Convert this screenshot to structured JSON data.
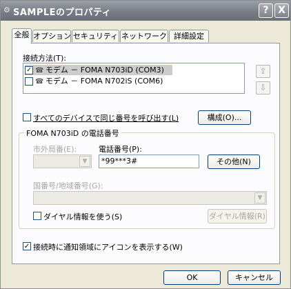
{
  "window": {
    "title": "SAMPLEのプロパティ",
    "help_label": "?",
    "close_label": "X"
  },
  "tabs": [
    "全般",
    "オプション",
    "セキュリティ",
    "ネットワーク",
    "詳細設定"
  ],
  "connect_method": {
    "label": "接続方法(T):",
    "items": [
      {
        "label": "モデム － FOMA N703iD (COM3)",
        "checked": true,
        "selected": true
      },
      {
        "label": "モデム － FOMA N702iS (COM6)",
        "checked": false,
        "selected": false
      }
    ],
    "up_icon": "⇧",
    "down_icon": "⇩"
  },
  "same_number": {
    "label": "すべてのデバイスで同じ番号を呼び出す(L)",
    "checked": false
  },
  "configure_button": "構成(O)...",
  "phone_group": {
    "title": "FOMA N703iD の電話番号",
    "area_code_label": "市外局番(E):",
    "phone_number_label": "電話番号(P):",
    "phone_number_value": "*99***3#",
    "others_button": "その他(N)",
    "country_label": "国番号/地域番号(G):",
    "use_dialing_rules": {
      "label": "ダイヤル情報を使う(S)",
      "checked": false
    },
    "dialing_rules_button": "ダイヤル情報(R)"
  },
  "show_icon": {
    "label": "接続時に通知領域にアイコンを表示する(W)",
    "checked": true
  },
  "footer": {
    "ok": "OK",
    "cancel": "キャンセル"
  }
}
